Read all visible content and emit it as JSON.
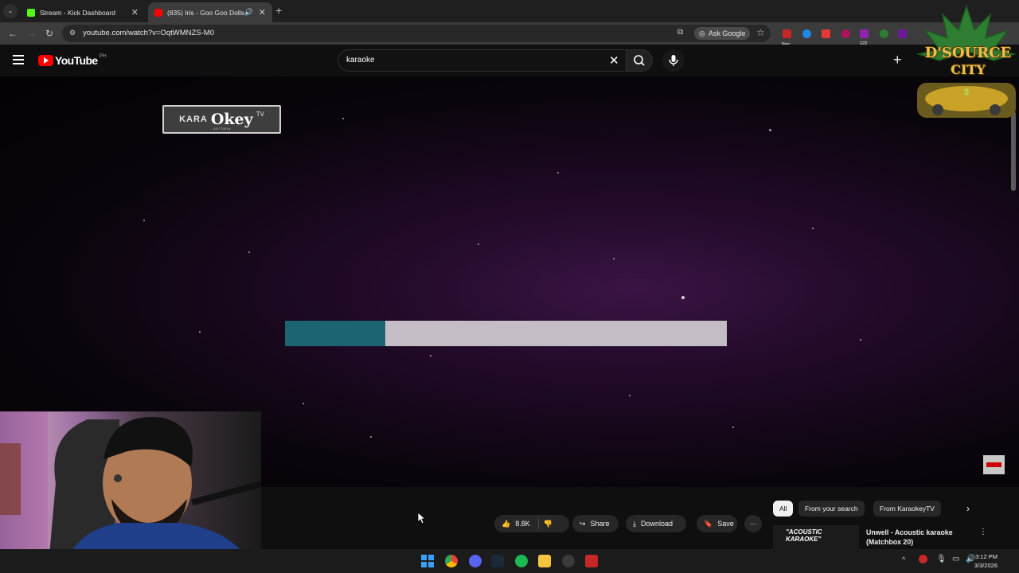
{
  "browser": {
    "tabs": [
      {
        "title": "Stream - Kick Dashboard",
        "favicon_color": "#53fc18"
      },
      {
        "title": "(835) Iris - Goo Goo Dolls (K",
        "favicon_color": "#ff0000"
      }
    ],
    "new_tab_label": "+",
    "url": "youtube.com/watch?v=OqtWMNZS-M0",
    "ask_google_label": "Ask Google",
    "extension_badge": "122",
    "extension_new_label": "New"
  },
  "youtube": {
    "logo_text": "YouTube",
    "country_code": "PH",
    "search_value": "karaoke"
  },
  "video": {
    "logo_kara": "KARA",
    "logo_okey": "Okey",
    "logo_tv": "TV",
    "logo_sub": "ANTONIA",
    "progress_fraction": 0.227,
    "progress_colors": {
      "fill": "#1d6473",
      "track": "#c4bdc6"
    }
  },
  "badge": {
    "line1": "D'SOURCE",
    "line2": "CITY"
  },
  "actions": {
    "like_count": "8.8K",
    "share_label": "Share",
    "download_label": "Download",
    "save_label": "Save"
  },
  "chips": {
    "all": "All",
    "from_search": "From your search",
    "from_channel": "From KaraokeyTV"
  },
  "recommendation": {
    "thumb_text": "\"ACOUSTIC KARAOKE\"",
    "title": "Unwell - Acoustic karaoke (Matchbox 20)"
  },
  "taskbar": {
    "time": "3:12 PM",
    "date": "3/3/2026"
  },
  "accent": {
    "youtube_red": "#ff0000",
    "kick_green": "#53fc18"
  }
}
